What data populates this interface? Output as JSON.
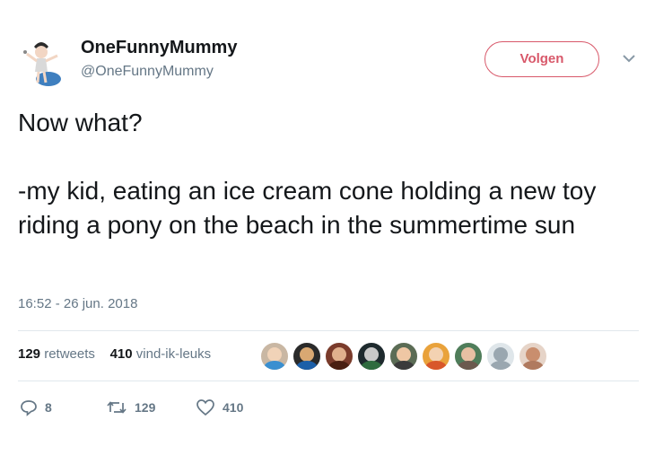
{
  "user": {
    "name": "OneFunnyMummy",
    "handle": "@OneFunnyMummy"
  },
  "follow_label": "Volgen",
  "tweet": {
    "line1": "Now what?",
    "line2": "-my kid, eating an ice cream cone holding a new toy riding a pony on the beach in the summertime sun"
  },
  "timestamp": "16:52 - 26 jun. 2018",
  "stats": {
    "retweets_count": "129",
    "retweets_label": "retweets",
    "likes_count": "410",
    "likes_label": "vind-ik-leuks"
  },
  "actions": {
    "replies": "8",
    "retweets": "129",
    "likes": "410"
  },
  "colors": {
    "accent": "#d8586a",
    "muted": "#657786",
    "text": "#14171a",
    "divider": "#e1e8ed"
  },
  "icons": [
    "avatar-icon",
    "chevron-down-icon",
    "reply-icon",
    "retweet-icon",
    "heart-icon"
  ]
}
